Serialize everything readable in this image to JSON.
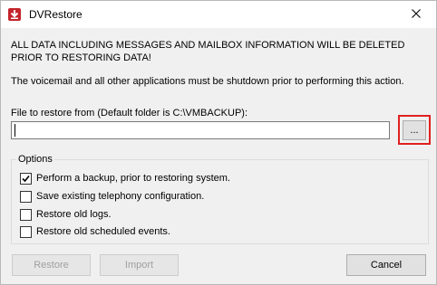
{
  "window": {
    "title": "DVRestore"
  },
  "warning_text": "ALL DATA INCLUDING MESSAGES AND MAILBOX INFORMATION WILL BE DELETED PRIOR TO RESTORING DATA!",
  "note_text": "The voicemail and all other applications must be shutdown prior to performing this action.",
  "file_field": {
    "label": "File to restore from (Default folder is C:\\VMBACKUP):",
    "value": "",
    "browse_label": "..."
  },
  "options": {
    "legend": "Options",
    "items": [
      {
        "label": "Perform a backup, prior to restoring system.",
        "checked": true
      },
      {
        "label": "Save existing telephony configuration.",
        "checked": false
      },
      {
        "label": "Restore old logs.",
        "checked": false
      },
      {
        "label": "Restore old scheduled events.",
        "checked": false
      }
    ]
  },
  "buttons": {
    "restore": {
      "label": "Restore",
      "enabled": false
    },
    "import": {
      "label": "Import",
      "enabled": false
    },
    "cancel": {
      "label": "Cancel",
      "enabled": true
    }
  },
  "colors": {
    "highlight": "#e02020",
    "app_icon": "#c4242b",
    "dialog_bg": "#f0f0f0"
  }
}
